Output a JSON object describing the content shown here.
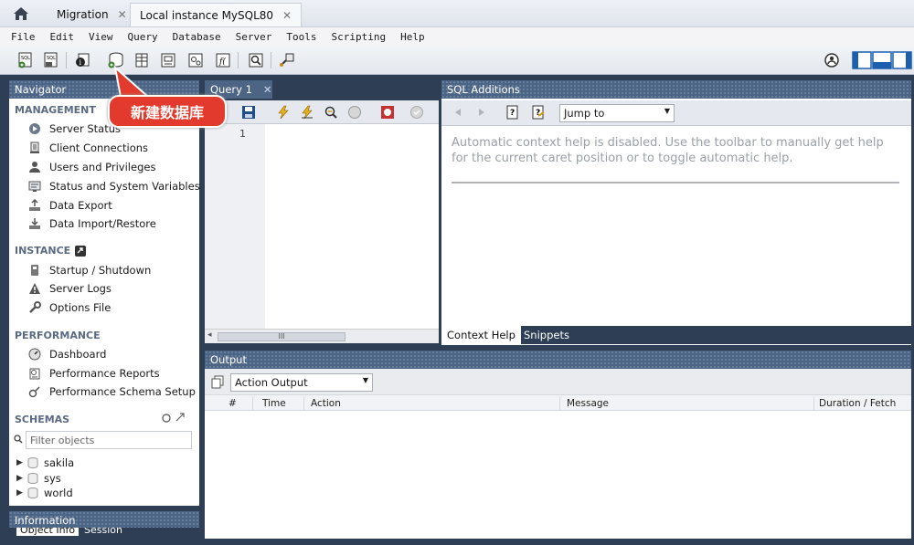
{
  "tabs": [
    {
      "label": "Migration"
    },
    {
      "label": "Local instance MySQL80"
    }
  ],
  "menu": [
    "File",
    "Edit",
    "View",
    "Query",
    "Database",
    "Server",
    "Tools",
    "Scripting",
    "Help"
  ],
  "navigator": {
    "title": "Navigator",
    "management_title": "MANAGEMENT",
    "management": [
      {
        "label": "Server Status",
        "icon": "server-status-icon"
      },
      {
        "label": "Client Connections",
        "icon": "client-connections-icon"
      },
      {
        "label": "Users and Privileges",
        "icon": "users-icon"
      },
      {
        "label": "Status and System Variables",
        "icon": "variables-icon"
      },
      {
        "label": "Data Export",
        "icon": "export-icon"
      },
      {
        "label": "Data Import/Restore",
        "icon": "import-icon"
      }
    ],
    "instance_title": "INSTANCE",
    "instance": [
      {
        "label": "Startup / Shutdown",
        "icon": "startup-icon"
      },
      {
        "label": "Server Logs",
        "icon": "warning-icon"
      },
      {
        "label": "Options File",
        "icon": "wrench-icon"
      }
    ],
    "performance_title": "PERFORMANCE",
    "performance": [
      {
        "label": "Dashboard",
        "icon": "dashboard-icon"
      },
      {
        "label": "Performance Reports",
        "icon": "reports-icon"
      },
      {
        "label": "Performance Schema Setup",
        "icon": "schema-setup-icon"
      }
    ],
    "schemas_title": "SCHEMAS",
    "filter_placeholder": "Filter objects",
    "schemas": [
      "sakila",
      "sys",
      "world"
    ]
  },
  "callout": "新建数据库",
  "query": {
    "tab_label": "Query 1",
    "line_number": "1"
  },
  "sql_additions": {
    "title": "SQL Additions",
    "jump_to": "Jump to",
    "help_text": "Automatic context help is disabled. Use the toolbar to manually get help for the current caret position or to toggle automatic help.",
    "tab_context_help": "Context Help",
    "tab_snippets": "Snippets"
  },
  "output": {
    "title": "Output",
    "selector": "Action Output",
    "columns": [
      "#",
      "Time",
      "Action",
      "Message",
      "Duration / Fetch"
    ]
  },
  "information": {
    "title": "Information",
    "tab_object_info": "Object Info",
    "tab_session": "Session"
  },
  "colors": {
    "workspace": "#2d3e55",
    "panel_header": "#4d6585",
    "callout": "#e23a2c"
  }
}
